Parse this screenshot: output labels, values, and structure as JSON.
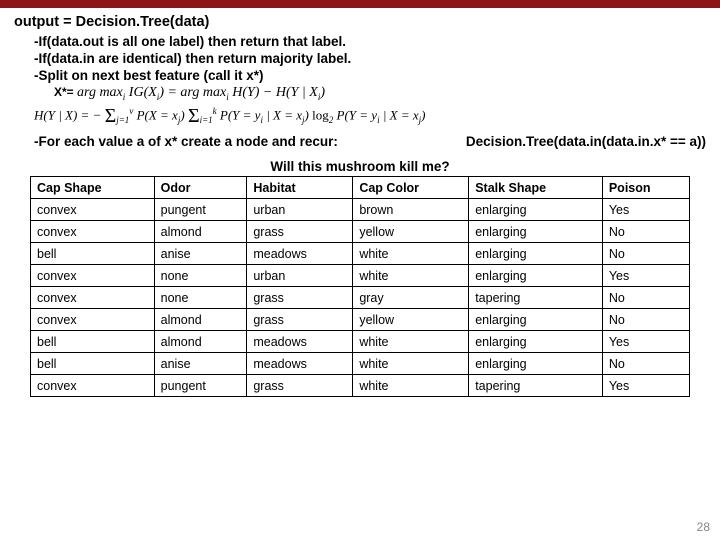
{
  "title": "output = Decision.Tree(data)",
  "algo": {
    "line1": "-If(data.out is all one label) then return that label.",
    "line2": "-If(data.in are identical) then return majority label.",
    "line3": "-Split on next best feature (call it x*)"
  },
  "formula1_prefix": "X*= ",
  "formula1_body": "arg max IG(Xᵢ) = arg max H(Y) − H(Y | Xᵢ)",
  "formula2": "H(Y | X) = − Σⱼ₌₁ᵛ P(X = xⱼ) Σᵢ₌₁ᵏ P(Y = yᵢ | X = xⱼ) log₂ P(Y = yᵢ | X = xⱼ)",
  "recur": {
    "left": "-For each value a of x* create a node and recur:",
    "right": "Decision.Tree(data.in(data.in.x* == a))"
  },
  "table": {
    "title": "Will this mushroom kill me?",
    "headers": [
      "Cap Shape",
      "Odor",
      "Habitat",
      "Cap Color",
      "Stalk Shape",
      "Poison"
    ],
    "rows": [
      [
        "convex",
        "pungent",
        "urban",
        "brown",
        "enlarging",
        "Yes"
      ],
      [
        "convex",
        "almond",
        "grass",
        "yellow",
        "enlarging",
        "No"
      ],
      [
        "bell",
        "anise",
        "meadows",
        "white",
        "enlarging",
        "No"
      ],
      [
        "convex",
        "none",
        "urban",
        "white",
        "enlarging",
        "Yes"
      ],
      [
        "convex",
        "none",
        "grass",
        "gray",
        "tapering",
        "No"
      ],
      [
        "convex",
        "almond",
        "grass",
        "yellow",
        "enlarging",
        "No"
      ],
      [
        "bell",
        "almond",
        "meadows",
        "white",
        "enlarging",
        "Yes"
      ],
      [
        "bell",
        "anise",
        "meadows",
        "white",
        "enlarging",
        "No"
      ],
      [
        "convex",
        "pungent",
        "grass",
        "white",
        "tapering",
        "Yes"
      ]
    ]
  },
  "page_number": "28"
}
